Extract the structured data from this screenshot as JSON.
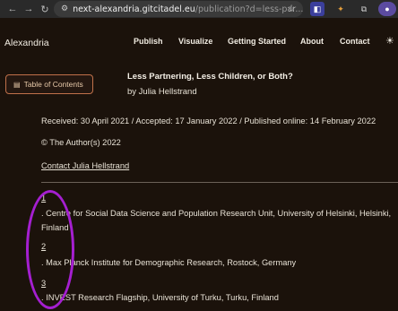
{
  "browser": {
    "url_host": "next-alexandria.gitcitadel.eu",
    "url_path": "/publication?d=less-par..."
  },
  "site": {
    "brand": "Alexandria",
    "nav": [
      "Publish",
      "Visualize",
      "Getting Started",
      "About",
      "Contact"
    ]
  },
  "sidebar": {
    "toc_label": "Table of Contents"
  },
  "article": {
    "title": "Less Partnering, Less Children, or Both?",
    "byline": "by Julia Hellstrand",
    "dates": "Received: 30 April 2021 / Accepted: 17 January 2022 / Published online: 14 February 2022",
    "copyright": "© The Author(s) 2022",
    "contact": "Contact Julia Hellstrand"
  },
  "references": [
    {
      "num": "1",
      "text": ". Centre for Social Data Science and Population Research Unit, University of Helsinki, Helsinki, Finland"
    },
    {
      "num": "2",
      "text": ". Max Planck Institute for Demographic Research, Rostock, Germany"
    },
    {
      "num": "3",
      "text": ". INVEST Research Flagship, University of Turku, Turku, Finland"
    }
  ],
  "colors": {
    "background": "#1b120b",
    "accent": "#c0714a",
    "highlight": "#a51fd1"
  }
}
